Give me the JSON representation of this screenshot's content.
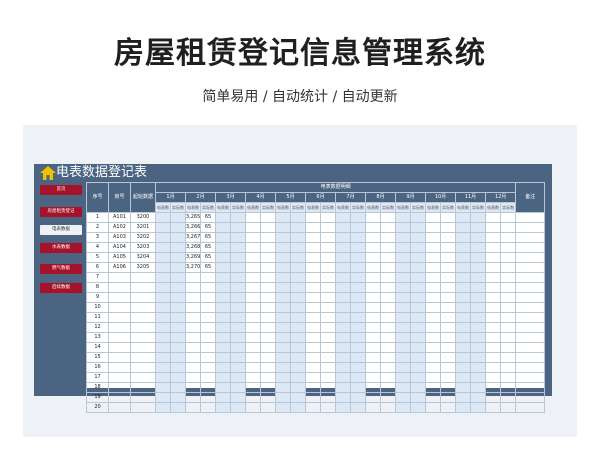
{
  "header": {
    "title": "房屋租赁登记信息管理系统",
    "subtitle": "简单易用 / 自动统计 / 自动更新"
  },
  "panel": {
    "title": "电表数据登记表"
  },
  "nav": [
    "首页",
    "房屋租赁登记",
    "电表数据",
    "水表数据",
    "燃气数据",
    "后续数据"
  ],
  "table": {
    "col_seq": "序号",
    "col_room": "房号",
    "col_start": "起始数据",
    "group_label": "电表数据明细",
    "months": [
      "1月",
      "2月",
      "3月",
      "4月",
      "5月",
      "6月",
      "7月",
      "8月",
      "9月",
      "10月",
      "11月",
      "12月"
    ],
    "sub_a": "电表数",
    "sub_b": "实际数",
    "col_note": "备注",
    "rows": [
      {
        "seq": "1",
        "room": "A101",
        "start": "3200",
        "m2a": "3,265",
        "m2b": "65"
      },
      {
        "seq": "2",
        "room": "A102",
        "start": "3201",
        "m2a": "3,266",
        "m2b": "65"
      },
      {
        "seq": "3",
        "room": "A103",
        "start": "3202",
        "m2a": "3,267",
        "m2b": "65"
      },
      {
        "seq": "4",
        "room": "A104",
        "start": "3203",
        "m2a": "3,268",
        "m2b": "65"
      },
      {
        "seq": "5",
        "room": "A105",
        "start": "3204",
        "m2a": "3,269",
        "m2b": "65"
      },
      {
        "seq": "6",
        "room": "A106",
        "start": "3205",
        "m2a": "3,270",
        "m2b": "65"
      },
      {
        "seq": "7"
      },
      {
        "seq": "8"
      },
      {
        "seq": "9"
      },
      {
        "seq": "10"
      },
      {
        "seq": "11"
      },
      {
        "seq": "12"
      },
      {
        "seq": "13"
      },
      {
        "seq": "14"
      },
      {
        "seq": "15"
      },
      {
        "seq": "16"
      },
      {
        "seq": "17"
      },
      {
        "seq": "18"
      },
      {
        "seq": "19"
      },
      {
        "seq": "20"
      }
    ]
  },
  "chart_data": {
    "type": "table",
    "title": "电表数据登记表",
    "columns": [
      "序号",
      "房号",
      "起始数据",
      "2月 电表数",
      "2月 实际数"
    ],
    "rows": [
      [
        "1",
        "A101",
        "3200",
        "3,265",
        "65"
      ],
      [
        "2",
        "A102",
        "3201",
        "3,266",
        "65"
      ],
      [
        "3",
        "A103",
        "3202",
        "3,267",
        "65"
      ],
      [
        "4",
        "A104",
        "3203",
        "3,268",
        "65"
      ],
      [
        "5",
        "A105",
        "3204",
        "3,269",
        "65"
      ],
      [
        "6",
        "A106",
        "3205",
        "3,270",
        "65"
      ]
    ]
  }
}
